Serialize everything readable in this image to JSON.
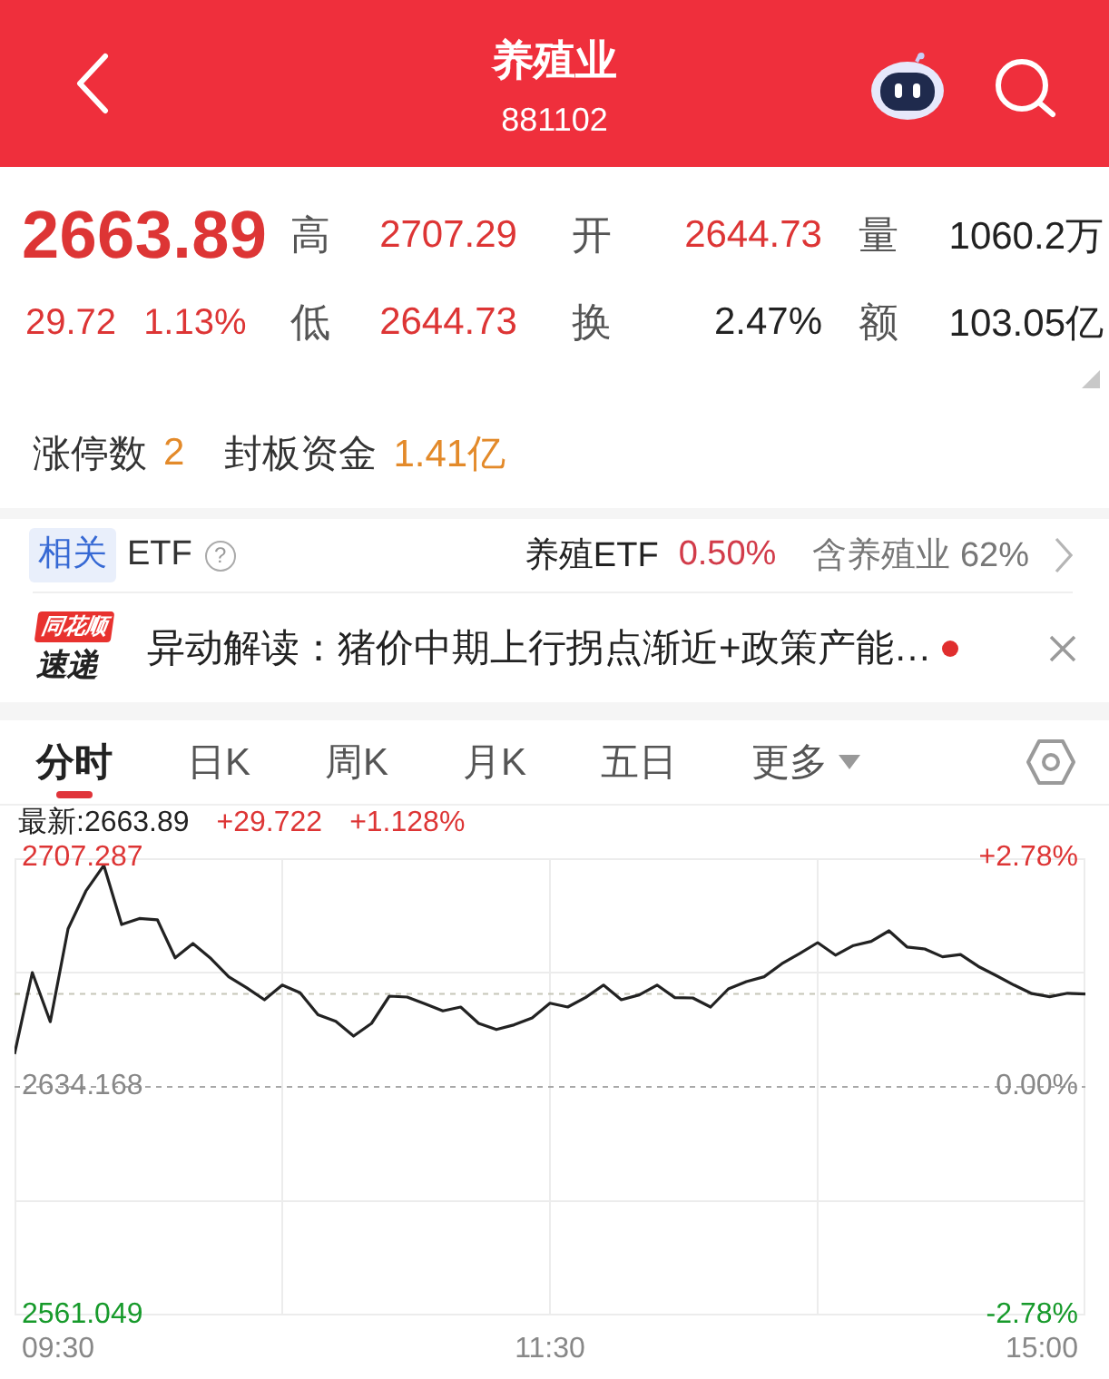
{
  "header": {
    "title": "养殖业",
    "code": "881102"
  },
  "quote": {
    "price": "2663.89",
    "change": "29.72",
    "change_pct": "1.13%",
    "color": "#dd3535",
    "stats": [
      [
        {
          "label": "高",
          "value": "2707.29",
          "color": "#dd3535"
        },
        {
          "label": "开",
          "value": "2644.73",
          "color": "#dd3535"
        },
        {
          "label": "量",
          "value": "1060.2万",
          "color": "#222222"
        }
      ],
      [
        {
          "label": "低",
          "value": "2644.73",
          "color": "#dd3535"
        },
        {
          "label": "换",
          "value": "2.47%",
          "color": "#222222"
        },
        {
          "label": "额",
          "value": "103.05亿",
          "color": "#222222"
        }
      ]
    ],
    "limit_up": [
      {
        "label": "涨停数",
        "value": "2"
      },
      {
        "label": "封板资金",
        "value": "1.41亿"
      }
    ]
  },
  "etf": {
    "tag": "相关",
    "label": "ETF",
    "help": "?",
    "fund": "养殖ETF",
    "fund_change": {
      "value": "0.50%",
      "color": "#d23c4a"
    },
    "holding": "含养殖业 62%"
  },
  "news": {
    "logo": [
      "同花顺",
      "速递"
    ],
    "text": "异动解读：猪价中期上行拐点渐近+政策产能…",
    "unread": true
  },
  "tabs": [
    {
      "label": "分时",
      "selected": true,
      "dropdown": false
    },
    {
      "label": "日K",
      "selected": false,
      "dropdown": false
    },
    {
      "label": "周K",
      "selected": false,
      "dropdown": false
    },
    {
      "label": "月K",
      "selected": false,
      "dropdown": false
    },
    {
      "label": "五日",
      "selected": false,
      "dropdown": false
    },
    {
      "label": "更多",
      "selected": false,
      "dropdown": true
    }
  ],
  "chart": {
    "latest": "最新:2663.89",
    "change": "+29.722",
    "change_pct": "+1.128%",
    "percent_labels": [
      "+2.78%",
      "0.00%",
      "-2.78%"
    ],
    "chart_data": {
      "type": "line",
      "categories": [
        null,
        null,
        null,
        null,
        null,
        null,
        null,
        null,
        null,
        null,
        null,
        null,
        null,
        null,
        null,
        null,
        null,
        null,
        null,
        null,
        null,
        null,
        null,
        null,
        null,
        null,
        null,
        null,
        null,
        null,
        null,
        null,
        null,
        null,
        null,
        null,
        null,
        null,
        null,
        null,
        null,
        null,
        null,
        null,
        null,
        null,
        null,
        null,
        null,
        null,
        null,
        null,
        null,
        null,
        null,
        null,
        null,
        null,
        null,
        null,
        null
      ],
      "series": [
        {
          "color": "#222222",
          "values": [
            2644.7,
            2670.7,
            2655.0,
            2684.7,
            2696.8,
            2705.0,
            2686.1,
            2688.0,
            2687.6,
            2675.4,
            2680.0,
            2675.2,
            2669.4,
            2665.9,
            2662.0,
            2666.7,
            2664.3,
            2657.2,
            2655.1,
            2650.4,
            2654.5,
            2663.2,
            2662.9,
            2660.7,
            2658.5,
            2659.7,
            2654.5,
            2652.5,
            2654.0,
            2656.2,
            2660.9,
            2659.7,
            2662.8,
            2666.7,
            2662.0,
            2663.6,
            2666.7,
            2662.7,
            2662.6,
            2659.7,
            2665.5,
            2667.8,
            2669.4,
            2673.6,
            2676.9,
            2680.3,
            2676.3,
            2679.4,
            2680.7,
            2684.1,
            2678.9,
            2678.3,
            2675.8,
            2676.5,
            2672.7,
            2669.8,
            2666.7,
            2664.0,
            2663.0,
            2664.1,
            2663.9
          ]
        }
      ],
      "ylim": [
        2561.049,
        2707.287
      ],
      "yticks": [
        {
          "value": 2707.287,
          "label": "2707.287"
        },
        {
          "value": 2634.168,
          "label": "2634.168"
        },
        {
          "value": 2561.049,
          "label": "2561.049"
        }
      ],
      "grid": true,
      "ref_lines": [
        {
          "axis": "y",
          "value": 2634.168,
          "color": "#a8a8a8"
        },
        {
          "axis": "y",
          "value": 2663.89,
          "color": "#c6c6b8"
        }
      ]
    },
    "time_labels": [
      "09:30",
      "11:30",
      "15:00"
    ]
  }
}
